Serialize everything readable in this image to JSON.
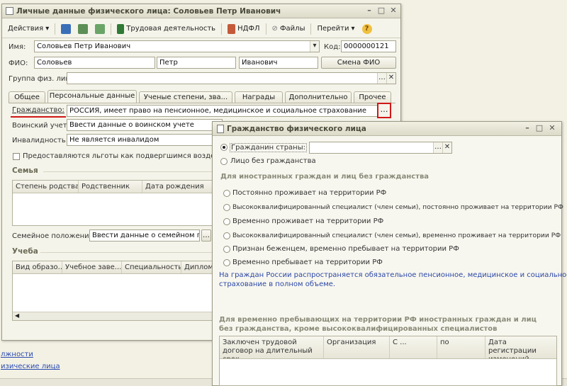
{
  "background": {
    "links": [
      "лжности",
      "изические лица"
    ]
  },
  "main_window": {
    "title": "Личные данные физического лица: Соловьев Петр Иванович",
    "toolbar": {
      "actions": "Действия",
      "labor": "Трудовая деятельность",
      "ndfl": "НДФЛ",
      "files": "Файлы",
      "goto": "Перейти"
    },
    "name_label": "Имя:",
    "name_value": "Соловьев Петр Иванович",
    "code_label": "Код:",
    "code_value": "0000000121",
    "fio_label": "ФИО:",
    "surname": "Соловьев",
    "firstname": "Петр",
    "patronymic": "Иванович",
    "change_fio": "Смена ФИО",
    "group_label": "Группа физ. лиц:",
    "group_value": "",
    "tabs": [
      "Общее",
      "Персональные данные",
      "Ученые степени, зва...",
      "Награды",
      "Дополнительно",
      "Прочее"
    ],
    "citizenship_label": "Гражданство:",
    "citizenship_value": "РОССИЯ, имеет право на пенсионное, медицинское и социальное страхование",
    "military_label": "Воинский учет:",
    "military_value": "Ввести данные о воинском учете",
    "disability_label": "Инвалидность:",
    "disability_value": "Не является инвалидом",
    "benefits_label": "Предоставляются льготы как подвергшимся воздействи...",
    "family_section": "Семья",
    "family_columns": [
      "Степень родства",
      "Родственник",
      "Дата рождения"
    ],
    "marital_label": "Семейное положение:",
    "marital_value": "Ввести данные о семейном пол...",
    "study_section": "Учеба",
    "study_columns": [
      "Вид образо...",
      "Учебное заве...",
      "Специальность",
      "Диплом..."
    ]
  },
  "dialog": {
    "title": "Гражданство физического лица",
    "citizen_option": "Гражданин страны:",
    "stateless_option": "Лицо без гражданства",
    "foreign_section": "Для иностранных граждан и лиц без гражданства",
    "options": [
      "Постоянно проживает на территории РФ",
      "Высококвалифицированный специалист (член семьи), постоянно проживает на территории РФ",
      "Временно проживает на территории РФ",
      "Высококвалифицированный специалист (член семьи), временно проживает на территории РФ",
      "Признан беженцем, временно пребывает на территории РФ",
      "Временно пребывает на территории РФ"
    ],
    "note_line1": "На граждан России распространяется обязательное пенсионное, медицинское и социальное",
    "note_line2": "страхование в полном объеме.",
    "temp_section_line1": "Для временно пребывающих на территории РФ иностранных граждан и лиц",
    "temp_section_line2": "без гражданства, кроме высококвалифицированных специалистов",
    "columns": [
      "Заключен трудовой договор на длительный срок",
      "Организация",
      "С ...",
      "по",
      "Дата регистрации изменений"
    ]
  }
}
